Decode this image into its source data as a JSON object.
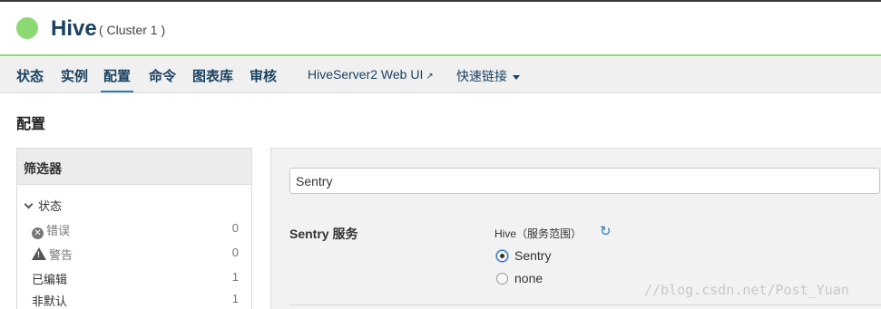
{
  "header": {
    "service_name": "Hive",
    "cluster": "( Cluster 1 )",
    "status_color": "#8cd872"
  },
  "nav": {
    "items": [
      "状态",
      "实例",
      "配置",
      "命令",
      "图表库",
      "审核"
    ],
    "active": "配置",
    "web_ui": "HiveServer2 Web UI",
    "quick_links": "快速链接"
  },
  "page": {
    "title": "配置"
  },
  "filter": {
    "title": "筛选器",
    "group": "状态",
    "rows": [
      {
        "label": "错误",
        "count": "0"
      },
      {
        "label": "警告",
        "count": "0"
      },
      {
        "label": "已编辑",
        "count": "1"
      },
      {
        "label": "非默认",
        "count": "1"
      }
    ]
  },
  "config": {
    "search_value": "Sentry",
    "property_label": "Sentry 服务",
    "scope": "Hive（服务范围）",
    "options": [
      "Sentry",
      "none"
    ],
    "selected": "Sentry"
  },
  "watermark": "//blog.csdn.net/Post_Yuan",
  "colors": {
    "accent": "#2b7fb8",
    "nav_text": "#1b4261",
    "status_green": "#8cd872"
  }
}
